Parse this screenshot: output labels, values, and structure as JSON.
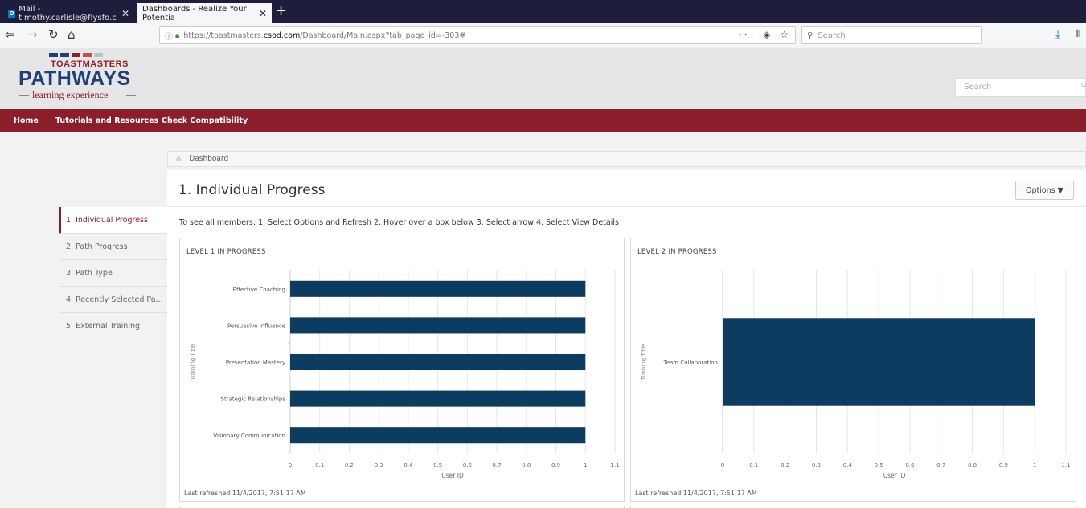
{
  "browser": {
    "tabs": [
      {
        "label": "Mail - timothy.carlisle@flysfo.c",
        "icon": "outlook-icon"
      },
      {
        "label": "Dashboards - Realize Your Potentia",
        "icon": ""
      }
    ],
    "url_prefix": "https://toastmasters.",
    "url_host": "csod.com",
    "url_path": "/Dashboard/Main.aspx?tab_page_id=-303#",
    "search_placeholder": "Search",
    "url_actions": "··· ◈ ☆"
  },
  "header": {
    "logo_top": "TOASTMASTERS",
    "logo_main": "PATHWAYS",
    "logo_sub": "learning experience",
    "logo_colors": [
      "#1f3f77",
      "#1f3f77",
      "#8a1f2b",
      "#c0504d",
      "#b9c4c9"
    ],
    "search_placeholder": "Search"
  },
  "nav": {
    "items": [
      "Home",
      "Tutorials and Resources",
      "Check Compatibility"
    ],
    "bg_color": "#8a1f2b"
  },
  "breadcrumb": {
    "label": "Dashboard"
  },
  "sidebar": {
    "items": [
      {
        "label": "1. Individual Progress",
        "active": true
      },
      {
        "label": "2. Path Progress",
        "active": false
      },
      {
        "label": "3. Path Type",
        "active": false
      },
      {
        "label": "4. Recently Selected Pa...",
        "active": false
      },
      {
        "label": "5. External Training",
        "active": false
      }
    ]
  },
  "main": {
    "title": "1. Individual Progress",
    "options_label": "Options ▼",
    "instructions": "To see all members: 1. Select Options and Refresh 2. Hover over a box below 3. Select arrow 4. Select View Details"
  },
  "chart_data": [
    {
      "type": "bar",
      "orientation": "horizontal",
      "title": "LEVEL 1 IN PROGRESS",
      "categories": [
        "Effective Coaching",
        "Persuasive Influence",
        "Presentation Mastery",
        "Strategic Relationships",
        "Visionary Communication"
      ],
      "values": [
        1,
        1,
        1,
        1,
        1
      ],
      "xlabel": "User ID",
      "ylabel": "Training Title",
      "xlim": [
        0,
        1.1
      ],
      "xticks": [
        "0",
        "0.1",
        "0.2",
        "0.3",
        "0.4",
        "0.5",
        "0.6",
        "0.7",
        "0.8",
        "0.9",
        "1",
        "1.1"
      ],
      "grid": true,
      "bar_color": "#0d3c61",
      "footer": "Last refreshed 11/4/2017, 7:51:17 AM"
    },
    {
      "type": "bar",
      "orientation": "horizontal",
      "title": "LEVEL 2 IN PROGRESS",
      "categories": [
        "Team Collaboration"
      ],
      "values": [
        1
      ],
      "xlabel": "User ID",
      "ylabel": "Training Title",
      "xlim": [
        0,
        1.1
      ],
      "xticks": [
        "0",
        "0.1",
        "0.2",
        "0.3",
        "0.4",
        "0.5",
        "0.6",
        "0.7",
        "0.8",
        "0.9",
        "1",
        "1.1"
      ],
      "grid": true,
      "bar_color": "#0d3c61",
      "footer": "Last refreshed 11/4/2017, 7:51:17 AM"
    }
  ]
}
